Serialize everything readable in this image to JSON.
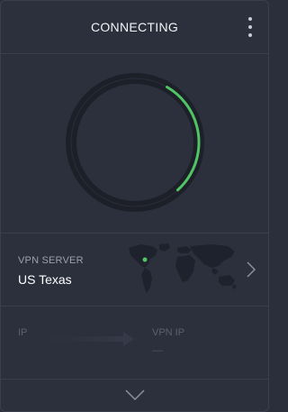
{
  "header": {
    "status_title": "CONNECTING",
    "menu_icon": "more-vertical-icon"
  },
  "connection": {
    "progress_percent": 30,
    "accent_color": "#4fc563"
  },
  "server": {
    "label": "VPN SERVER",
    "value": "US Texas",
    "map_icon": "world-map-icon",
    "chevron_icon": "chevron-right-icon"
  },
  "ip": {
    "ip_label": "IP",
    "vpn_ip_label": "VPN IP",
    "vpn_ip_value": "—"
  },
  "footer": {
    "expand_icon": "chevron-down-icon"
  }
}
